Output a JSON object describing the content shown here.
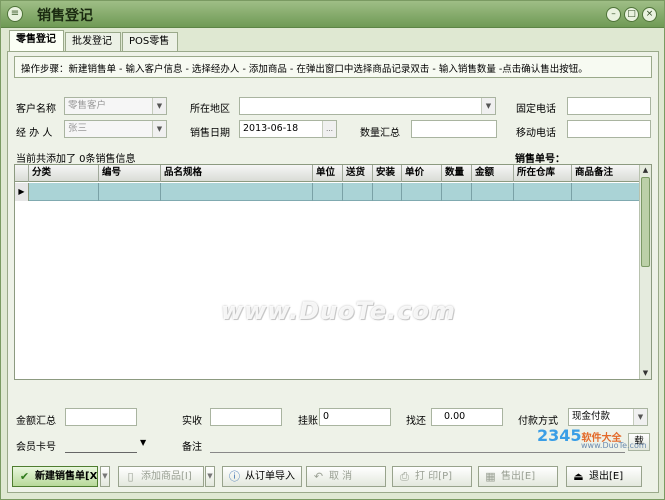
{
  "window": {
    "title": "销售登记"
  },
  "tabs": [
    {
      "label": "零售登记",
      "active": true
    },
    {
      "label": "批发登记",
      "active": false
    },
    {
      "label": "POS零售",
      "active": false
    }
  ],
  "steps_text": "操作步骤：新建销售单 - 输入客户信息 - 选择经办人 - 添加商品 - 在弹出窗口中选择商品记录双击 - 输入销售数量 -点击确认售出按钮。",
  "form": {
    "customer_label": "客户名称",
    "customer_value": "零售客户",
    "region_label": "所在地区",
    "region_value": "",
    "phone_label": "固定电话",
    "phone_value": "",
    "handler_label": "经 办 人",
    "handler_value": "张三",
    "date_label": "销售日期",
    "date_value": "2013-06-18",
    "qty_sum_label": "数量汇总",
    "qty_sum_value": "",
    "mobile_label": "移动电话",
    "mobile_value": ""
  },
  "summary": {
    "added_text": "当前共添加了 0条销售信息",
    "order_no_label": "销售单号："
  },
  "grid": {
    "columns": [
      "分类",
      "编号",
      "品名规格",
      "单位",
      "送货",
      "安装",
      "单价",
      "数量",
      "金额",
      "所在仓库",
      "商品备注"
    ],
    "row_indicator": "▶"
  },
  "watermark": "www.DuoTe.com",
  "footer": {
    "amount_label": "金额汇总",
    "amount_value": "",
    "received_label": "实收",
    "received_value": "",
    "credit_label": "挂账",
    "credit_value": "0",
    "change_label": "找还",
    "change_value": "0.00",
    "pay_label": "付款方式",
    "pay_value": "现金付款",
    "member_label": "会员卡号",
    "member_value": "",
    "note_label": "备注",
    "note_value": "",
    "load_btn": "载"
  },
  "buttons": {
    "new_order": "新建销售单[X]",
    "add_goods": "添加商品[I]",
    "import_order": "从订单导入",
    "cancel": "取 消",
    "print": "打 印[P]",
    "confirm": "售出[E]",
    "exit": "退出[E]"
  },
  "logo": {
    "brand": "2345",
    "suffix": "软件大全",
    "site": "www.DuoTe.com"
  }
}
